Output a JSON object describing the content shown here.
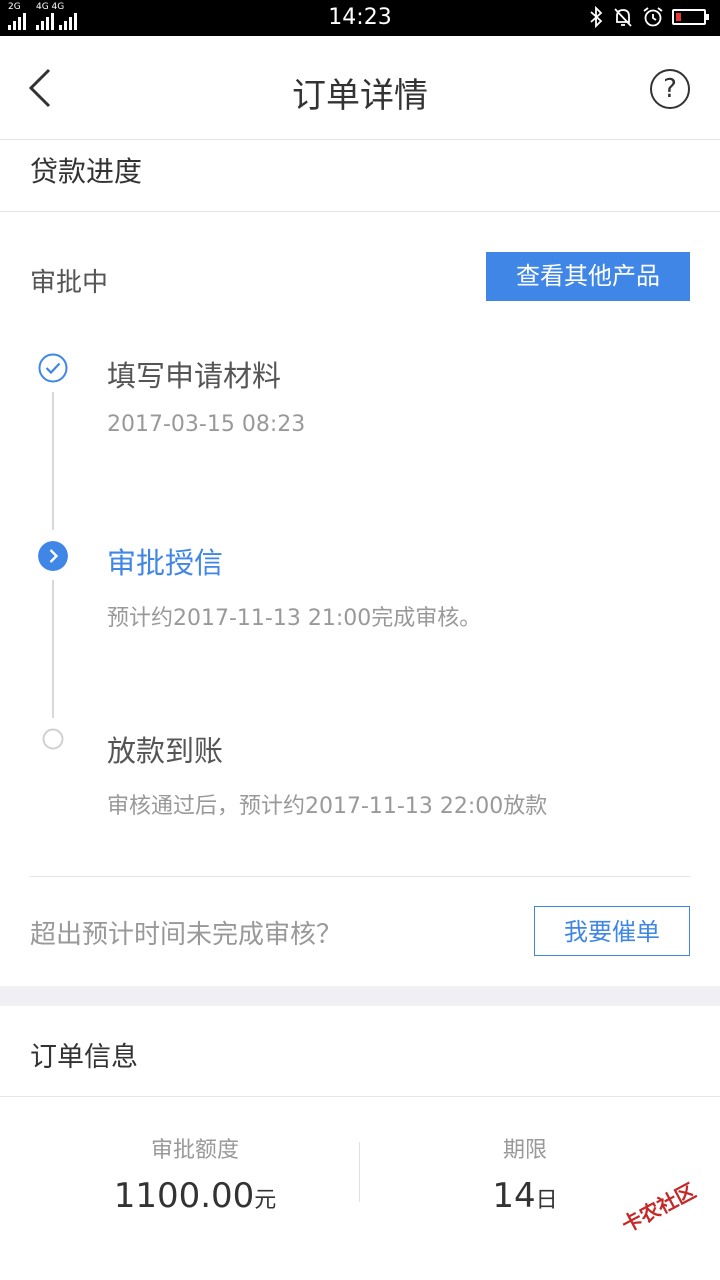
{
  "status_bar": {
    "signal1_label": "2G",
    "signal2_label": "4G 4G",
    "time": "14:23",
    "battery_color": "#e53935"
  },
  "nav": {
    "title": "订单详情",
    "help_glyph": "?"
  },
  "progress_section": {
    "title": "贷款进度",
    "status": "审批中",
    "other_products_button": "查看其他产品",
    "steps": [
      {
        "title": "填写申请材料",
        "sub": "2017-03-15 08:23",
        "state": "done"
      },
      {
        "title": "审批授信",
        "sub": "预计约2017-11-13 21:00完成审核。",
        "state": "current"
      },
      {
        "title": "放款到账",
        "sub": "审核通过后，预计约2017-11-13 22:00放款",
        "state": "pending"
      }
    ],
    "overdue_question": "超出预计时间未完成审核？",
    "urge_button": "我要催单"
  },
  "order_info": {
    "title": "订单信息",
    "amount_label": "审批额度",
    "amount_value": "1100.00",
    "amount_unit": "元",
    "term_label": "期限",
    "term_value": "14",
    "term_unit": "日"
  },
  "watermark": "卡农社区",
  "colors": {
    "accent": "#3f86e6",
    "text": "#333333",
    "muted": "#999999"
  }
}
